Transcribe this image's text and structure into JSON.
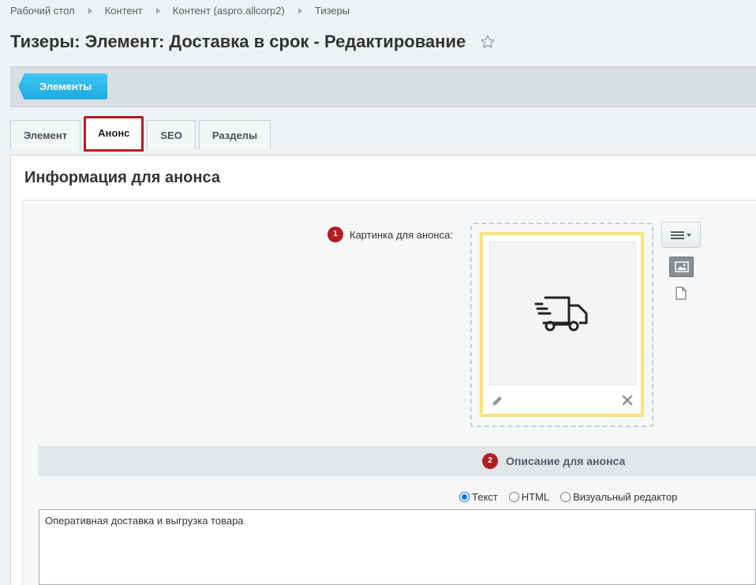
{
  "breadcrumb": [
    "Рабочий стол",
    "Контент",
    "Контент (aspro.allcorp2)",
    "Тизеры"
  ],
  "page_title": "Тизеры: Элемент: Доставка в срок - Редактирование",
  "toolbar": {
    "elements_button": "Элементы"
  },
  "tabs": [
    {
      "label": "Элемент",
      "active": false
    },
    {
      "label": "Анонс",
      "active": true
    },
    {
      "label": "SEO",
      "active": false
    },
    {
      "label": "Разделы",
      "active": false
    }
  ],
  "section_title": "Информация для анонса",
  "preview_picture": {
    "badge": "1",
    "label": "Картинка для анонса:",
    "image_icon": "delivery-truck-icon"
  },
  "description": {
    "badge": "2",
    "title": "Описание для анонса",
    "modes": [
      {
        "label": "Текст",
        "checked": true
      },
      {
        "label": "HTML",
        "checked": false
      },
      {
        "label": "Визуальный редактор",
        "checked": false
      }
    ],
    "text": "Оперативная доставка и выгрузка товара"
  },
  "colors": {
    "accent_red": "#b01e23",
    "button_blue": "#1fa9e0",
    "highlight_yellow": "#f9e27a"
  }
}
